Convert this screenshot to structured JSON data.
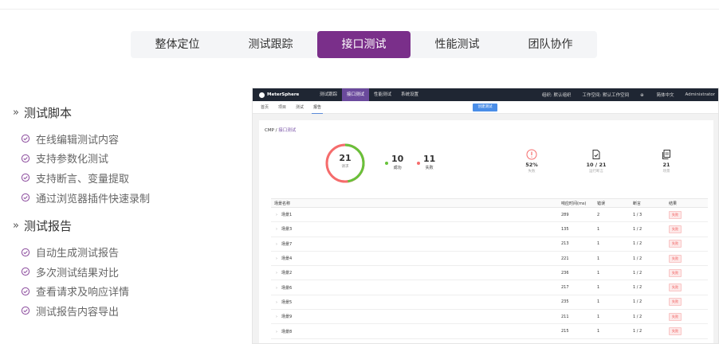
{
  "tabs": [
    {
      "label": "整体定位",
      "active": false
    },
    {
      "label": "测试跟踪",
      "active": false
    },
    {
      "label": "接口测试",
      "active": true
    },
    {
      "label": "性能测试",
      "active": false
    },
    {
      "label": "团队协作",
      "active": false
    }
  ],
  "left": {
    "section1_title": "测试脚本",
    "section1_items": [
      "在线编辑测试内容",
      "支持参数化测试",
      "支持断言、变量提取",
      "通过浏览器插件快速录制"
    ],
    "section2_title": "测试报告",
    "section2_items": [
      "自动生成测试报告",
      "多次测试结果对比",
      "查看请求及响应详情",
      "测试报告内容导出"
    ]
  },
  "app": {
    "logo": "MeterSphere",
    "nav": [
      "测试跟踪",
      "接口测试",
      "性能测试",
      "系统设置"
    ],
    "nav_active": 1,
    "org": "组织: 默认组织",
    "workspace": "工作空间: 默认工作空间",
    "lang": "简体中文",
    "user": "Administrator",
    "subnav": [
      "首页",
      "项目",
      "测试",
      "报告"
    ],
    "subnav_active": 3,
    "create_button": "创建测试",
    "breadcrumb_prefix": "CMP / ",
    "breadcrumb_current": "接口测试",
    "total": "21",
    "total_label": "请求",
    "success": "10",
    "success_label": "成功",
    "fail": "11",
    "fail_label": "失败",
    "metrics": [
      {
        "value": "52%",
        "label": "失败",
        "icon": "alert-circle-icon"
      },
      {
        "value": "10 / 21",
        "label": "运行断言",
        "icon": "document-check-icon"
      },
      {
        "value": "21",
        "label": "场景",
        "icon": "copy-icon"
      }
    ],
    "table_headers": [
      "场景名称",
      "响应时间(ms)",
      "错误",
      "断言",
      "结果"
    ],
    "rows": [
      {
        "name": "场景1",
        "time": "289",
        "err": "2",
        "assert": "1 / 3",
        "result": "失败"
      },
      {
        "name": "场景3",
        "time": "135",
        "err": "1",
        "assert": "1 / 2",
        "result": "失败"
      },
      {
        "name": "场景7",
        "time": "213",
        "err": "1",
        "assert": "1 / 2",
        "result": "失败"
      },
      {
        "name": "场景4",
        "time": "221",
        "err": "1",
        "assert": "1 / 2",
        "result": "失败"
      },
      {
        "name": "场景2",
        "time": "236",
        "err": "1",
        "assert": "1 / 2",
        "result": "失败"
      },
      {
        "name": "场景6",
        "time": "217",
        "err": "1",
        "assert": "1 / 2",
        "result": "失败"
      },
      {
        "name": "场景5",
        "time": "235",
        "err": "1",
        "assert": "1 / 2",
        "result": "失败"
      },
      {
        "name": "场景9",
        "time": "211",
        "err": "1",
        "assert": "1 / 2",
        "result": "失败"
      },
      {
        "name": "场景8",
        "time": "215",
        "err": "1",
        "assert": "1 / 2",
        "result": "失败"
      }
    ]
  },
  "colors": {
    "accent": "#7a2f8a",
    "success": "#67c23a",
    "fail": "#f56c6c"
  }
}
